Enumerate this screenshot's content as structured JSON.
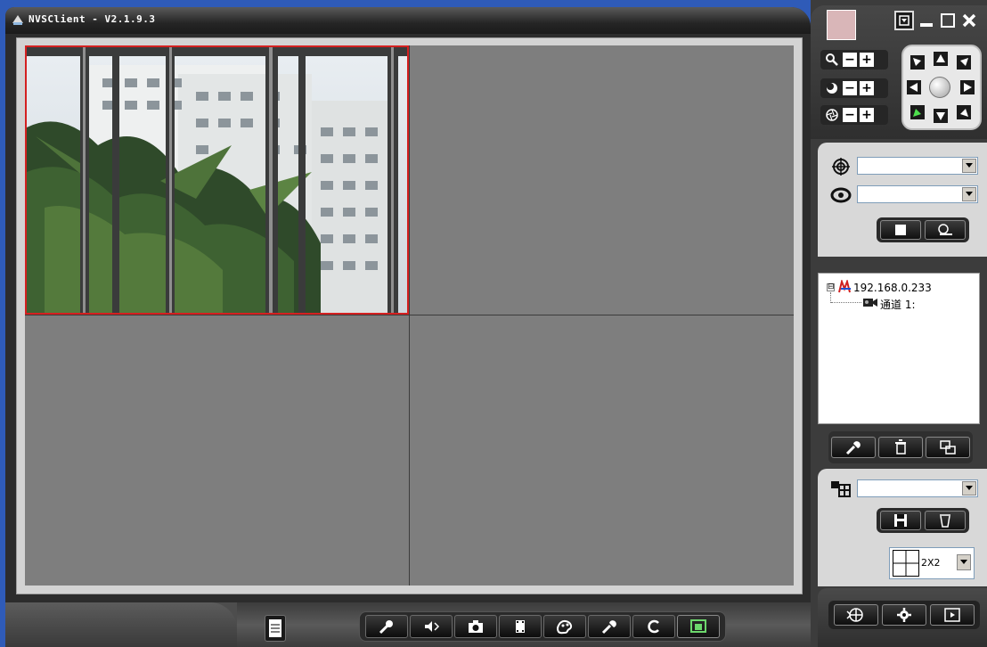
{
  "window": {
    "title": "NVSClient - V2.1.9.3"
  },
  "colors": {
    "title_bar": "#252525",
    "video_background": "#7e7e7e",
    "active_pane_border": "#d42020",
    "swatch": "#d9b6b8",
    "panel_light": "#d8d8d8",
    "panel_dark": "#3c3c3c",
    "desktop": "#2f5bb8"
  },
  "window_controls": {
    "menu": "dropdown-icon",
    "minimize": "minimize-icon",
    "maximize": "maximize-icon",
    "close": "close-icon"
  },
  "ptz": {
    "zoom_minus": "−",
    "zoom_plus": "+",
    "focus_minus": "−",
    "focus_plus": "+",
    "iris_minus": "−",
    "iris_plus": "+"
  },
  "preset": {
    "preset_value": "",
    "cruise_value": ""
  },
  "device_tree": {
    "expand_symbol": "⊟",
    "node": "192.168.0.233",
    "channel": "通道 1:"
  },
  "layout": {
    "view_value": "",
    "grid_label": "2X2"
  },
  "bottom_toolbar": {
    "items": [
      "mic-icon",
      "volume-icon",
      "snapshot-icon",
      "record-icon",
      "color-icon",
      "settings-icon",
      "refresh-icon",
      "fullscreen-icon"
    ]
  }
}
